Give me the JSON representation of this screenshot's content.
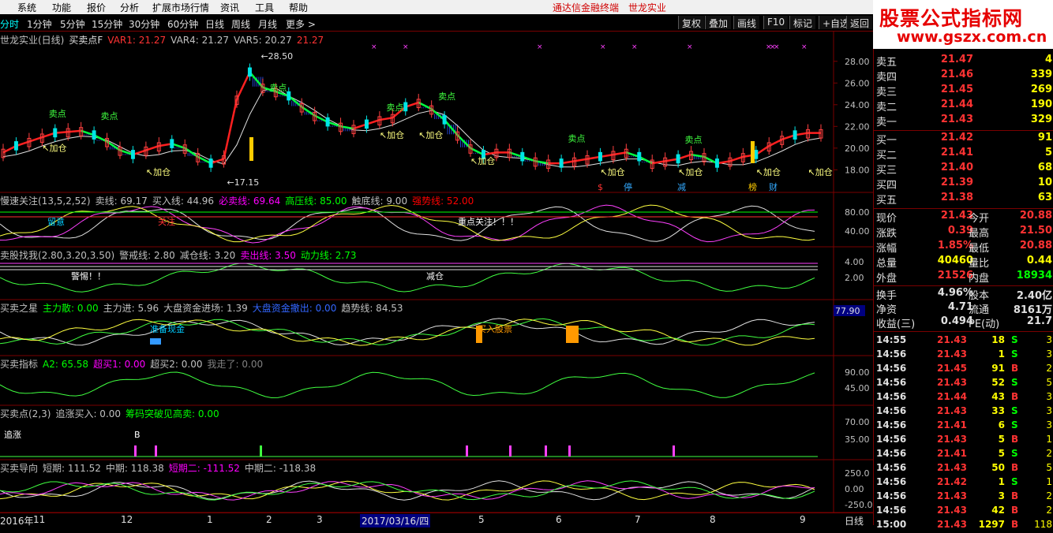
{
  "menu": {
    "items": [
      "系统",
      "功能",
      "报价",
      "分析",
      "扩展市场行情",
      "资讯",
      "工具",
      "帮助"
    ],
    "app_title": "通达信金融终端",
    "stock_title": "世龙实业"
  },
  "periods": [
    "分时",
    "1分钟",
    "5分钟",
    "15分钟",
    "30分钟",
    "60分钟",
    "日线",
    "周线",
    "月线",
    "更多 >"
  ],
  "tools": [
    "复权",
    "叠加",
    "画线",
    "F10",
    "标记",
    "+自选",
    "返回"
  ],
  "logo": {
    "line1": "股票公式指标网",
    "line2": "www.gszx.com.cn"
  },
  "main_title": {
    "name": "世龙实业(日线)",
    "indicator": "买卖点F",
    "var1": "VAR1: 21.27",
    "var4": "VAR4: 21.27",
    "var5": "VAR5: 20.27",
    "extra": "21.27"
  },
  "main_axis": [
    "28.00",
    "26.00",
    "24.00",
    "22.00",
    "20.00",
    "18.00"
  ],
  "main_annotations": {
    "high": "28.50",
    "low": "17.15",
    "add": "加仓",
    "sell": "卖点",
    "markers": [
      "$",
      "停",
      "减",
      "榜",
      "财"
    ]
  },
  "panels": [
    {
      "title": [
        [
          "慢速关注(13,5,2,52)",
          "#c0c0c0"
        ],
        [
          "卖线: 69.17",
          "#c0c0c0"
        ],
        [
          "买入线: 44.96",
          "#c0c0c0"
        ],
        [
          "必卖线: 69.64",
          "#ff00ff"
        ],
        [
          "高压线: 85.00",
          "#00ff00"
        ],
        [
          "触底线: 9.00",
          "#c0c0c0"
        ],
        [
          "强势线: 52.00",
          "#ff0000"
        ]
      ],
      "axis": [
        "80.00",
        "40.00"
      ],
      "labels": [
        "留意",
        "重点关注！！！",
        "关注"
      ]
    },
    {
      "title": [
        [
          "卖股找我(2.80,3.20,3.50)",
          "#c0c0c0"
        ],
        [
          "警戒线: 2.80",
          "#c0c0c0"
        ],
        [
          "减仓线: 3.20",
          "#c0c0c0"
        ],
        [
          "卖出线: 3.50",
          "#ff00ff"
        ],
        [
          "动力线: 2.73",
          "#00ff00"
        ]
      ],
      "axis": [
        "4.00",
        "2.00"
      ],
      "labels": [
        "警惕！！",
        "减仓"
      ]
    },
    {
      "title": [
        [
          "买卖之星",
          "#c0c0c0"
        ],
        [
          "主力散: 0.00",
          "#00ff00"
        ],
        [
          "主力进: 5.96",
          "#c0c0c0"
        ],
        [
          "大盘资金进场: 1.39",
          "#c0c0c0"
        ],
        [
          "大盘资金撤出: 0.00",
          "#3366ff"
        ],
        [
          "趋势线: 84.53",
          "#c0c0c0"
        ]
      ],
      "axis": [
        "77.90"
      ],
      "labels": [
        "准备现金",
        "买入股票"
      ]
    },
    {
      "title": [
        [
          "买卖指标",
          "#c0c0c0"
        ],
        [
          "A2: 65.58",
          "#00ff00"
        ],
        [
          "超买1: 0.00",
          "#ff00ff"
        ],
        [
          "超买2: 0.00",
          "#c0c0c0"
        ],
        [
          "我走了: 0.00",
          "#808080"
        ]
      ],
      "axis": [
        "90.00",
        "45.00"
      ],
      "labels": []
    },
    {
      "title": [
        [
          "买卖点(2,3)",
          "#c0c0c0"
        ],
        [
          "追涨买入: 0.00",
          "#c0c0c0"
        ],
        [
          "筹码突破见高卖: 0.00",
          "#00ff00"
        ]
      ],
      "axis": [
        "70.00",
        "35.00"
      ],
      "labels": [
        "追涨",
        "B"
      ]
    },
    {
      "title": [
        [
          "买卖导向",
          "#c0c0c0"
        ],
        [
          "短期: 111.52",
          "#c0c0c0"
        ],
        [
          "中期: 118.38",
          "#c0c0c0"
        ],
        [
          "短期二: -111.52",
          "#ff00ff"
        ],
        [
          "中期二: -118.38",
          "#c0c0c0"
        ]
      ],
      "axis": [
        "250.0",
        "0.00",
        "-250.0"
      ],
      "labels": []
    }
  ],
  "bottom_axis": {
    "labels": [
      "2016年",
      "11",
      "12",
      "1",
      "2",
      "3",
      "2017/03/16/四",
      "5",
      "6",
      "7",
      "8",
      "9"
    ],
    "period": "日线"
  },
  "quote": {
    "asks": [
      {
        "label": "卖五",
        "price": "21.47",
        "vol": "4"
      },
      {
        "label": "卖四",
        "price": "21.46",
        "vol": "339"
      },
      {
        "label": "卖三",
        "price": "21.45",
        "vol": "269"
      },
      {
        "label": "卖二",
        "price": "21.44",
        "vol": "190"
      },
      {
        "label": "卖一",
        "price": "21.43",
        "vol": "329"
      }
    ],
    "bids": [
      {
        "label": "买一",
        "price": "21.42",
        "vol": "91"
      },
      {
        "label": "买二",
        "price": "21.41",
        "vol": "5"
      },
      {
        "label": "买三",
        "price": "21.40",
        "vol": "68"
      },
      {
        "label": "买四",
        "price": "21.39",
        "vol": "10"
      },
      {
        "label": "买五",
        "price": "21.38",
        "vol": "63"
      }
    ],
    "stats": [
      {
        "l1": "现价",
        "v1": "21.43",
        "c1": "#ff3333",
        "l2": "今开",
        "v2": "20.88",
        "c2": "#ff3333"
      },
      {
        "l1": "涨跌",
        "v1": "0.39",
        "c1": "#ff3333",
        "l2": "最高",
        "v2": "21.50",
        "c2": "#ff3333"
      },
      {
        "l1": "涨幅",
        "v1": "1.85%",
        "c1": "#ff3333",
        "l2": "最低",
        "v2": "20.88",
        "c2": "#ff3333"
      },
      {
        "l1": "总量",
        "v1": "40460",
        "c1": "#ffff00",
        "l2": "量比",
        "v2": "0.44",
        "c2": "#ffff00"
      },
      {
        "l1": "外盘",
        "v1": "21526",
        "c1": "#ff3333",
        "l2": "内盘",
        "v2": "18934",
        "c2": "#00ff00"
      }
    ],
    "fin": [
      {
        "l1": "换手",
        "v1": "4.96%",
        "l2": "股本",
        "v2": "2.40亿"
      },
      {
        "l1": "净资",
        "v1": "4.71",
        "l2": "流通",
        "v2": "8161万"
      },
      {
        "l1": "收益(三)",
        "v1": "0.494",
        "l2": "PE(动)",
        "v2": "21.7"
      }
    ],
    "ticks": [
      {
        "t": "14:55",
        "p": "21.43",
        "v": "18",
        "f": "S",
        "n": "3",
        "c": "#ff3333",
        "fc": "#00ff00"
      },
      {
        "t": "14:56",
        "p": "21.43",
        "v": "1",
        "f": "S",
        "n": "3",
        "c": "#ff3333",
        "fc": "#00ff00"
      },
      {
        "t": "14:56",
        "p": "21.45",
        "v": "91",
        "f": "B",
        "n": "2",
        "c": "#ff3333",
        "fc": "#ff3333"
      },
      {
        "t": "14:56",
        "p": "21.43",
        "v": "52",
        "f": "S",
        "n": "5",
        "c": "#ff3333",
        "fc": "#00ff00"
      },
      {
        "t": "14:56",
        "p": "21.44",
        "v": "43",
        "f": "B",
        "n": "3",
        "c": "#ff3333",
        "fc": "#ff3333"
      },
      {
        "t": "14:56",
        "p": "21.43",
        "v": "33",
        "f": "S",
        "n": "3",
        "c": "#ff3333",
        "fc": "#00ff00"
      },
      {
        "t": "14:56",
        "p": "21.41",
        "v": "6",
        "f": "S",
        "n": "3",
        "c": "#ff3333",
        "fc": "#00ff00"
      },
      {
        "t": "14:56",
        "p": "21.43",
        "v": "5",
        "f": "B",
        "n": "1",
        "c": "#ff3333",
        "fc": "#ff3333"
      },
      {
        "t": "14:56",
        "p": "21.41",
        "v": "5",
        "f": "S",
        "n": "2",
        "c": "#ff3333",
        "fc": "#00ff00"
      },
      {
        "t": "14:56",
        "p": "21.43",
        "v": "50",
        "f": "B",
        "n": "5",
        "c": "#ff3333",
        "fc": "#ff3333"
      },
      {
        "t": "14:56",
        "p": "21.42",
        "v": "1",
        "f": "S",
        "n": "1",
        "c": "#ff3333",
        "fc": "#00ff00"
      },
      {
        "t": "14:56",
        "p": "21.43",
        "v": "3",
        "f": "B",
        "n": "2",
        "c": "#ff3333",
        "fc": "#ff3333"
      },
      {
        "t": "14:56",
        "p": "21.43",
        "v": "42",
        "f": "B",
        "n": "2",
        "c": "#ff3333",
        "fc": "#ff3333"
      },
      {
        "t": "15:00",
        "p": "21.43",
        "v": "1297",
        "f": "B",
        "n": "118",
        "c": "#ff3333",
        "fc": "#ff3333"
      }
    ]
  },
  "chart_data": {
    "type": "line",
    "title": "世龙实业(日线)",
    "ylim": [
      16.5,
      29
    ],
    "high_label": 28.5,
    "low_label": 17.15,
    "series": [
      {
        "name": "VAR1",
        "values": [
          19.6,
          20.2,
          20.6,
          21.0,
          21.4,
          21.5,
          21.6,
          21.2,
          20.6,
          19.8,
          19.4,
          19.8,
          20.2,
          20.4,
          20.0,
          19.2,
          18.6,
          19.0,
          24.5,
          27.0,
          25.6,
          25.2,
          24.8,
          23.8,
          23.0,
          22.4,
          22.0,
          21.8,
          22.2,
          22.6,
          22.8,
          23.8,
          24.2,
          23.6,
          22.6,
          21.2,
          20.0,
          19.4,
          19.6,
          19.6,
          19.2,
          18.8,
          18.6,
          18.6,
          18.8,
          19.0,
          19.2,
          19.4,
          19.6,
          19.2,
          18.6,
          18.8,
          19.0,
          19.4,
          19.2,
          18.6,
          18.8,
          19.2,
          19.4,
          20.2,
          20.8,
          21.2,
          21.4,
          21.4
        ]
      }
    ]
  }
}
